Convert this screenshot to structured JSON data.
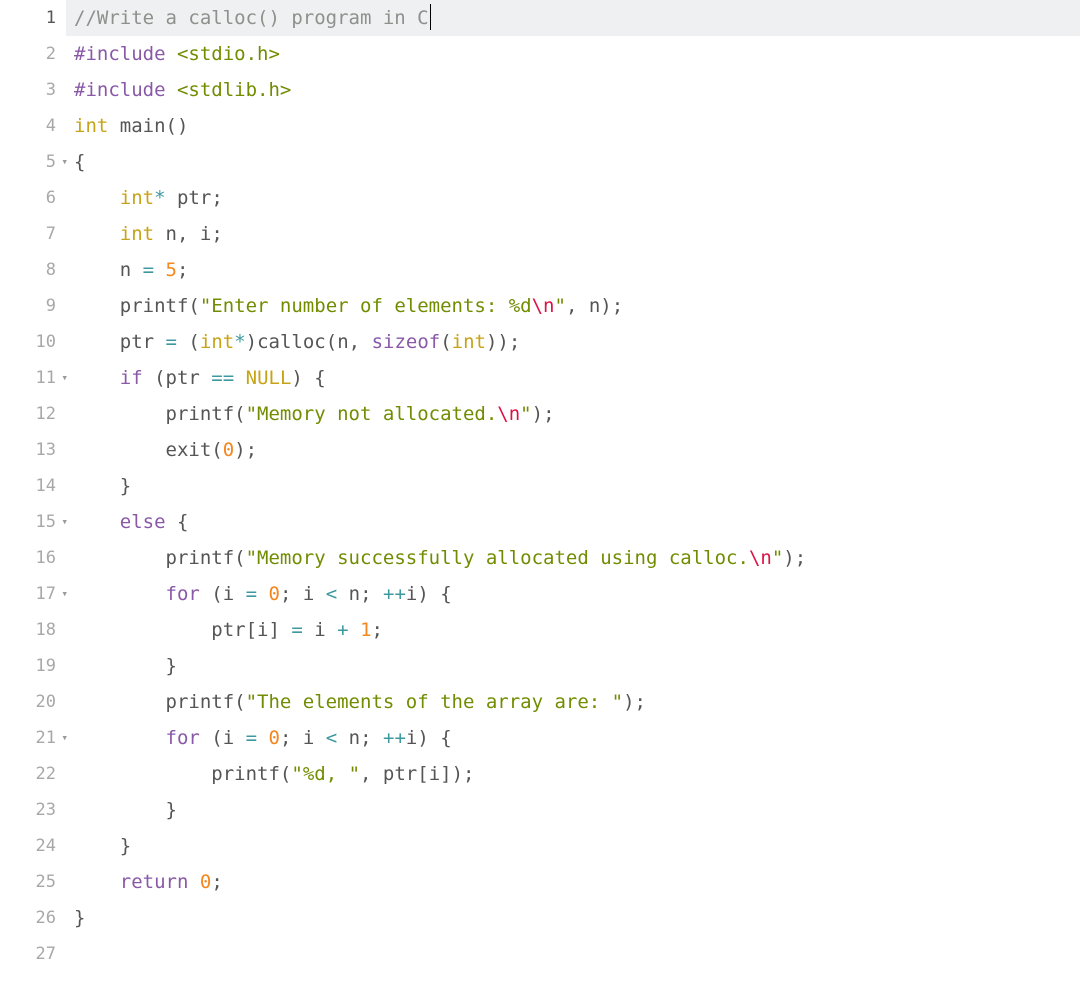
{
  "editor": {
    "active_line": 1,
    "fold_lines": [
      5,
      11,
      15,
      17,
      21
    ],
    "lines": [
      {
        "n": 1,
        "tokens": [
          {
            "t": "//Write a calloc() program in C",
            "c": "tok-comment"
          }
        ],
        "cursor": true
      },
      {
        "n": 2,
        "tokens": [
          {
            "t": "#include ",
            "c": "tok-keyword"
          },
          {
            "t": "<stdio.h>",
            "c": "tok-include"
          }
        ]
      },
      {
        "n": 3,
        "tokens": [
          {
            "t": "#include ",
            "c": "tok-keyword"
          },
          {
            "t": "<stdlib.h>",
            "c": "tok-include"
          }
        ]
      },
      {
        "n": 4,
        "tokens": [
          {
            "t": "int",
            "c": "tok-type"
          },
          {
            "t": " ",
            "c": "tok-ident"
          },
          {
            "t": "main",
            "c": "tok-func"
          },
          {
            "t": "()",
            "c": "tok-punc"
          }
        ]
      },
      {
        "n": 5,
        "tokens": [
          {
            "t": "{",
            "c": "tok-punc"
          }
        ]
      },
      {
        "n": 6,
        "tokens": [
          {
            "t": "    ",
            "c": ""
          },
          {
            "t": "int",
            "c": "tok-type"
          },
          {
            "t": "*",
            "c": "tok-op"
          },
          {
            "t": " ptr",
            "c": "tok-ident"
          },
          {
            "t": ";",
            "c": "tok-punc"
          }
        ]
      },
      {
        "n": 7,
        "tokens": [
          {
            "t": "    ",
            "c": ""
          },
          {
            "t": "int",
            "c": "tok-type"
          },
          {
            "t": " n",
            "c": "tok-ident"
          },
          {
            "t": ",",
            "c": "tok-punc"
          },
          {
            "t": " i",
            "c": "tok-ident"
          },
          {
            "t": ";",
            "c": "tok-punc"
          }
        ]
      },
      {
        "n": 8,
        "tokens": [
          {
            "t": "    n ",
            "c": "tok-ident"
          },
          {
            "t": "=",
            "c": "tok-op"
          },
          {
            "t": " ",
            "c": ""
          },
          {
            "t": "5",
            "c": "tok-number"
          },
          {
            "t": ";",
            "c": "tok-punc"
          }
        ]
      },
      {
        "n": 9,
        "tokens": [
          {
            "t": "    ",
            "c": ""
          },
          {
            "t": "printf",
            "c": "tok-func"
          },
          {
            "t": "(",
            "c": "tok-punc"
          },
          {
            "t": "\"Enter number of elements: %d",
            "c": "tok-string"
          },
          {
            "t": "\\n",
            "c": "tok-escape"
          },
          {
            "t": "\"",
            "c": "tok-string"
          },
          {
            "t": ",",
            "c": "tok-punc"
          },
          {
            "t": " n",
            "c": "tok-ident"
          },
          {
            "t": ");",
            "c": "tok-punc"
          }
        ]
      },
      {
        "n": 10,
        "tokens": [
          {
            "t": "    ptr ",
            "c": "tok-ident"
          },
          {
            "t": "=",
            "c": "tok-op"
          },
          {
            "t": " ",
            "c": ""
          },
          {
            "t": "(",
            "c": "tok-punc"
          },
          {
            "t": "int",
            "c": "tok-type"
          },
          {
            "t": "*",
            "c": "tok-op"
          },
          {
            "t": ")",
            "c": "tok-punc"
          },
          {
            "t": "calloc",
            "c": "tok-func"
          },
          {
            "t": "(",
            "c": "tok-punc"
          },
          {
            "t": "n",
            "c": "tok-ident"
          },
          {
            "t": ",",
            "c": "tok-punc"
          },
          {
            "t": " ",
            "c": ""
          },
          {
            "t": "sizeof",
            "c": "tok-keyword"
          },
          {
            "t": "(",
            "c": "tok-punc"
          },
          {
            "t": "int",
            "c": "tok-type"
          },
          {
            "t": "));",
            "c": "tok-punc"
          }
        ]
      },
      {
        "n": 11,
        "tokens": [
          {
            "t": "    ",
            "c": ""
          },
          {
            "t": "if",
            "c": "tok-keyword"
          },
          {
            "t": " (ptr ",
            "c": "tok-ident"
          },
          {
            "t": "==",
            "c": "tok-op"
          },
          {
            "t": " ",
            "c": ""
          },
          {
            "t": "NULL",
            "c": "tok-type"
          },
          {
            "t": ") {",
            "c": "tok-punc"
          }
        ]
      },
      {
        "n": 12,
        "tokens": [
          {
            "t": "        ",
            "c": ""
          },
          {
            "t": "printf",
            "c": "tok-func"
          },
          {
            "t": "(",
            "c": "tok-punc"
          },
          {
            "t": "\"Memory not allocated.",
            "c": "tok-string"
          },
          {
            "t": "\\n",
            "c": "tok-escape"
          },
          {
            "t": "\"",
            "c": "tok-string"
          },
          {
            "t": ");",
            "c": "tok-punc"
          }
        ]
      },
      {
        "n": 13,
        "tokens": [
          {
            "t": "        ",
            "c": ""
          },
          {
            "t": "exit",
            "c": "tok-func"
          },
          {
            "t": "(",
            "c": "tok-punc"
          },
          {
            "t": "0",
            "c": "tok-number"
          },
          {
            "t": ");",
            "c": "tok-punc"
          }
        ]
      },
      {
        "n": 14,
        "tokens": [
          {
            "t": "    }",
            "c": "tok-punc"
          }
        ]
      },
      {
        "n": 15,
        "tokens": [
          {
            "t": "    ",
            "c": ""
          },
          {
            "t": "else",
            "c": "tok-keyword"
          },
          {
            "t": " {",
            "c": "tok-punc"
          }
        ]
      },
      {
        "n": 16,
        "tokens": [
          {
            "t": "        ",
            "c": ""
          },
          {
            "t": "printf",
            "c": "tok-func"
          },
          {
            "t": "(",
            "c": "tok-punc"
          },
          {
            "t": "\"Memory successfully allocated using calloc.",
            "c": "tok-string"
          },
          {
            "t": "\\n",
            "c": "tok-escape"
          },
          {
            "t": "\"",
            "c": "tok-string"
          },
          {
            "t": ");",
            "c": "tok-punc"
          }
        ]
      },
      {
        "n": 17,
        "tokens": [
          {
            "t": "        ",
            "c": ""
          },
          {
            "t": "for",
            "c": "tok-keyword"
          },
          {
            "t": " (i ",
            "c": "tok-ident"
          },
          {
            "t": "=",
            "c": "tok-op"
          },
          {
            "t": " ",
            "c": ""
          },
          {
            "t": "0",
            "c": "tok-number"
          },
          {
            "t": ";",
            "c": "tok-punc"
          },
          {
            "t": " i ",
            "c": "tok-ident"
          },
          {
            "t": "<",
            "c": "tok-op"
          },
          {
            "t": " n",
            "c": "tok-ident"
          },
          {
            "t": ";",
            "c": "tok-punc"
          },
          {
            "t": " ",
            "c": ""
          },
          {
            "t": "++",
            "c": "tok-op"
          },
          {
            "t": "i",
            "c": "tok-ident"
          },
          {
            "t": ") {",
            "c": "tok-punc"
          }
        ]
      },
      {
        "n": 18,
        "tokens": [
          {
            "t": "            ptr",
            "c": "tok-ident"
          },
          {
            "t": "[",
            "c": "tok-punc"
          },
          {
            "t": "i",
            "c": "tok-ident"
          },
          {
            "t": "] ",
            "c": "tok-punc"
          },
          {
            "t": "=",
            "c": "tok-op"
          },
          {
            "t": " i ",
            "c": "tok-ident"
          },
          {
            "t": "+",
            "c": "tok-op"
          },
          {
            "t": " ",
            "c": ""
          },
          {
            "t": "1",
            "c": "tok-number"
          },
          {
            "t": ";",
            "c": "tok-punc"
          }
        ]
      },
      {
        "n": 19,
        "tokens": [
          {
            "t": "        }",
            "c": "tok-punc"
          }
        ]
      },
      {
        "n": 20,
        "tokens": [
          {
            "t": "        ",
            "c": ""
          },
          {
            "t": "printf",
            "c": "tok-func"
          },
          {
            "t": "(",
            "c": "tok-punc"
          },
          {
            "t": "\"The elements of the array are: \"",
            "c": "tok-string"
          },
          {
            "t": ");",
            "c": "tok-punc"
          }
        ]
      },
      {
        "n": 21,
        "tokens": [
          {
            "t": "        ",
            "c": ""
          },
          {
            "t": "for",
            "c": "tok-keyword"
          },
          {
            "t": " (i ",
            "c": "tok-ident"
          },
          {
            "t": "=",
            "c": "tok-op"
          },
          {
            "t": " ",
            "c": ""
          },
          {
            "t": "0",
            "c": "tok-number"
          },
          {
            "t": ";",
            "c": "tok-punc"
          },
          {
            "t": " i ",
            "c": "tok-ident"
          },
          {
            "t": "<",
            "c": "tok-op"
          },
          {
            "t": " n",
            "c": "tok-ident"
          },
          {
            "t": ";",
            "c": "tok-punc"
          },
          {
            "t": " ",
            "c": ""
          },
          {
            "t": "++",
            "c": "tok-op"
          },
          {
            "t": "i",
            "c": "tok-ident"
          },
          {
            "t": ") {",
            "c": "tok-punc"
          }
        ]
      },
      {
        "n": 22,
        "tokens": [
          {
            "t": "            ",
            "c": ""
          },
          {
            "t": "printf",
            "c": "tok-func"
          },
          {
            "t": "(",
            "c": "tok-punc"
          },
          {
            "t": "\"%d, \"",
            "c": "tok-string"
          },
          {
            "t": ",",
            "c": "tok-punc"
          },
          {
            "t": " ptr",
            "c": "tok-ident"
          },
          {
            "t": "[",
            "c": "tok-punc"
          },
          {
            "t": "i",
            "c": "tok-ident"
          },
          {
            "t": "]);",
            "c": "tok-punc"
          }
        ]
      },
      {
        "n": 23,
        "tokens": [
          {
            "t": "        }",
            "c": "tok-punc"
          }
        ]
      },
      {
        "n": 24,
        "tokens": [
          {
            "t": "    }",
            "c": "tok-punc"
          }
        ]
      },
      {
        "n": 25,
        "tokens": [
          {
            "t": "    ",
            "c": ""
          },
          {
            "t": "return",
            "c": "tok-keyword"
          },
          {
            "t": " ",
            "c": ""
          },
          {
            "t": "0",
            "c": "tok-number"
          },
          {
            "t": ";",
            "c": "tok-punc"
          }
        ]
      },
      {
        "n": 26,
        "tokens": [
          {
            "t": "}",
            "c": "tok-punc"
          }
        ]
      },
      {
        "n": 27,
        "tokens": []
      }
    ]
  }
}
